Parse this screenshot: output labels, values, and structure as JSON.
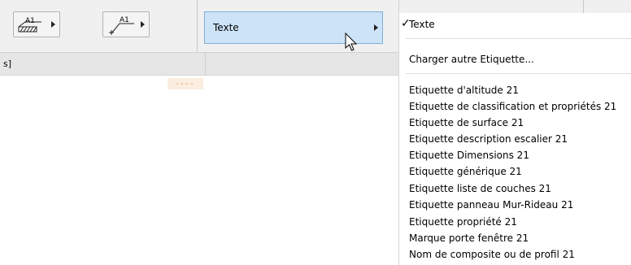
{
  "toolbar": {
    "button1_icon": "label-pointer-hatch-icon",
    "button1_text": "A1",
    "button2_icon": "label-leader-icon",
    "button2_text": "A1",
    "dropdown_label": "Texte"
  },
  "subbar": {
    "text": "s]"
  },
  "canvas": {
    "dashes": "----"
  },
  "menu": {
    "checked_item": "Texte",
    "load_item": "Charger autre Etiquette...",
    "items": [
      "Etiquette d'altitude 21",
      "Etiquette de classification et propriétés 21",
      "Etiquette de surface 21",
      "Etiquette description escalier 21",
      "Etiquette Dimensions 21",
      "Etiquette générique 21",
      "Etiquette liste de couches 21",
      "Etiquette panneau Mur-Rideau 21",
      "Etiquette propriété 21",
      "Marque porte fenêtre 21",
      "Nom de composite ou de profil 21"
    ]
  }
}
